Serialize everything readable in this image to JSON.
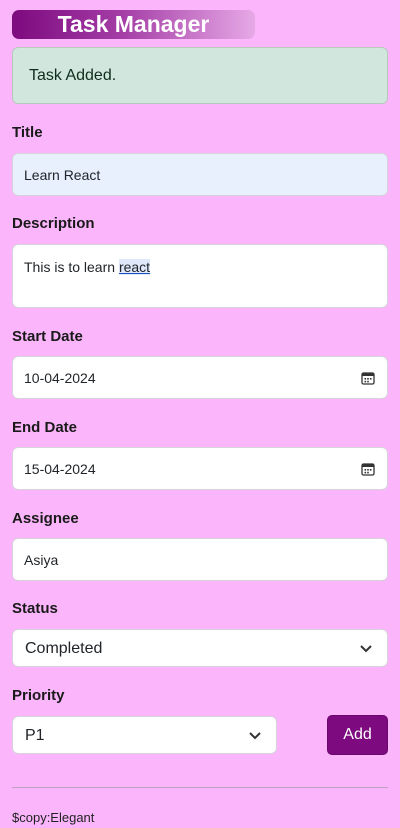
{
  "header": {
    "title": "Task Manager"
  },
  "alert": {
    "message": "Task Added."
  },
  "form": {
    "title": {
      "label": "Title",
      "value": "Learn React"
    },
    "description": {
      "label": "Description",
      "value_prefix": "This is to learn ",
      "value_word": "react"
    },
    "start_date": {
      "label": "Start Date",
      "value": "10-04-2024",
      "icon": "calendar-icon"
    },
    "end_date": {
      "label": "End Date",
      "value": "15-04-2024",
      "icon": "calendar-icon"
    },
    "assignee": {
      "label": "Assignee",
      "value": "Asiya"
    },
    "status": {
      "label": "Status",
      "value": "Completed",
      "icon": "chevron-down-icon"
    },
    "priority": {
      "label": "Priority",
      "value": "P1",
      "icon": "chevron-down-icon"
    },
    "add_label": "Add"
  },
  "footer": {
    "text": "$copy:Elegant"
  },
  "colors": {
    "background": "#fbb6fb",
    "accent": "#7d0a7f",
    "alert_bg": "#d1e7dd"
  }
}
